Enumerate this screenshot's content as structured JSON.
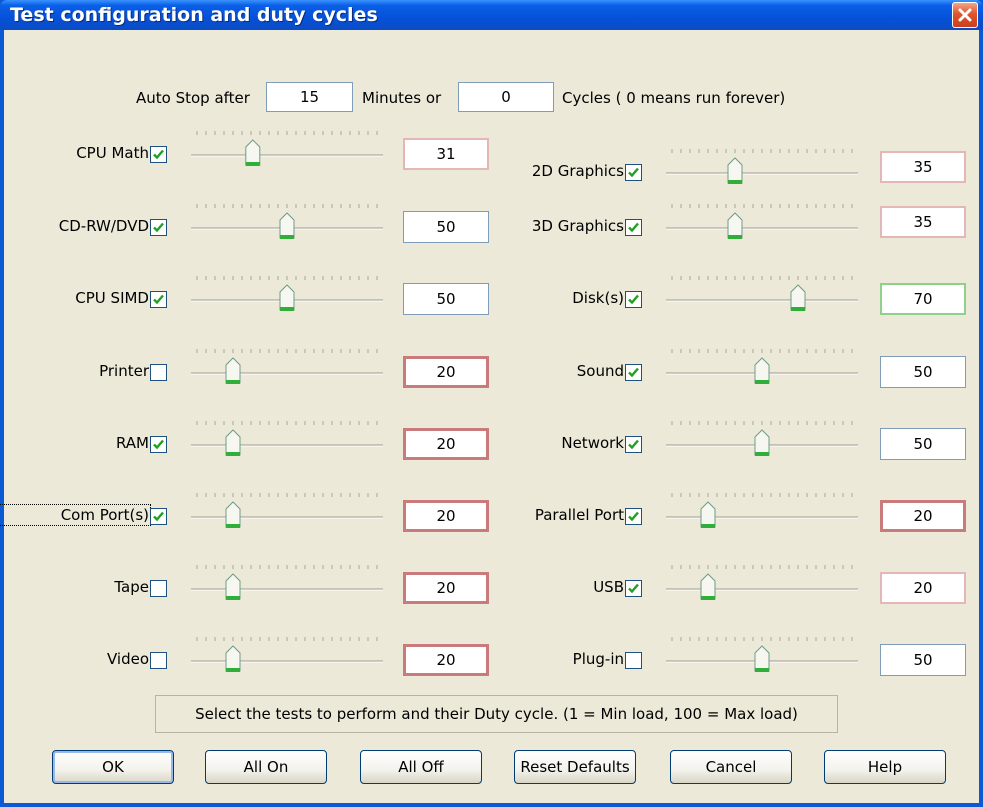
{
  "window": {
    "title": "Test configuration and duty cycles"
  },
  "autostop": {
    "label_before": "Auto Stop after",
    "minutes_value": "15",
    "minutes_label": "Minutes or",
    "cycles_value": "0",
    "cycles_label": "Cycles ( 0 means run forever)"
  },
  "tests_left": [
    {
      "label": "CPU Math",
      "checked": true,
      "value": "31",
      "level": 31
    },
    {
      "label": "CD-RW/DVD",
      "checked": true,
      "value": "50",
      "level": 50
    },
    {
      "label": "CPU SIMD",
      "checked": true,
      "value": "50",
      "level": 50
    },
    {
      "label": "Printer",
      "checked": false,
      "value": "20",
      "level": 20
    },
    {
      "label": "RAM",
      "checked": true,
      "value": "20",
      "level": 20
    },
    {
      "label": "Com Port(s)",
      "checked": true,
      "value": "20",
      "level": 20
    },
    {
      "label": "Tape",
      "checked": false,
      "value": "20",
      "level": 20
    },
    {
      "label": "Video",
      "checked": false,
      "value": "20",
      "level": 20
    }
  ],
  "tests_right": [
    {
      "label": "2D Graphics",
      "checked": true,
      "value": "35",
      "level": 35
    },
    {
      "label": "3D Graphics",
      "checked": true,
      "value": "35",
      "level": 35
    },
    {
      "label": "Disk(s)",
      "checked": true,
      "value": "70",
      "level": 70
    },
    {
      "label": "Sound",
      "checked": true,
      "value": "50",
      "level": 50
    },
    {
      "label": "Network",
      "checked": true,
      "value": "50",
      "level": 50
    },
    {
      "label": "Parallel Port",
      "checked": true,
      "value": "20",
      "level": 20
    },
    {
      "label": "USB",
      "checked": true,
      "value": "20",
      "level": 20
    },
    {
      "label": "Plug-in",
      "checked": false,
      "value": "50",
      "level": 50
    }
  ],
  "status_text": "Select the tests to perform and their Duty cycle. (1 = Min load, 100 = Max load)",
  "buttons": {
    "ok": "OK",
    "all_on": "All On",
    "all_off": "All Off",
    "reset_defaults": "Reset Defaults",
    "cancel": "Cancel",
    "help": "Help"
  },
  "colors": {
    "titlebar": "#0551d8",
    "dialog_bg": "#ece9d8",
    "box_red": "#c97a7a",
    "box_green": "#8fd08c",
    "close_red": "#e0552c"
  },
  "icons": {
    "close": "close-icon",
    "check": "checkmark-icon"
  }
}
